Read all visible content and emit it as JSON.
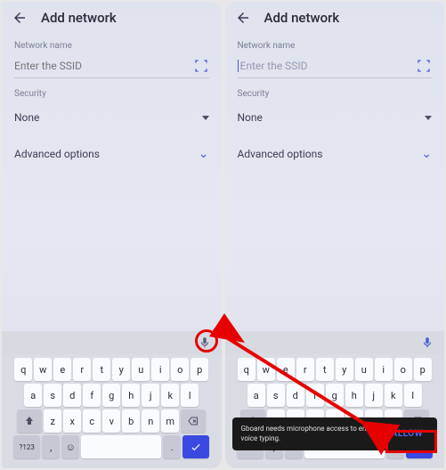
{
  "left": {
    "title": "Add network",
    "network_label": "Network name",
    "placeholder": "Enter the SSID",
    "security_label": "Security",
    "security_value": "None",
    "advanced": "Advanced options"
  },
  "right": {
    "title": "Add network",
    "network_label": "Network name",
    "placeholder": "Enter the SSID",
    "security_label": "Security",
    "security_value": "None",
    "advanced": "Advanced options",
    "snackbar_text": "Gboard needs microphone access to enable voice typing.",
    "allow": "ALLOW"
  },
  "keyboard": {
    "row1": [
      "q",
      "w",
      "e",
      "r",
      "t",
      "y",
      "u",
      "i",
      "o",
      "p"
    ],
    "row2": [
      "a",
      "s",
      "d",
      "f",
      "g",
      "h",
      "j",
      "k",
      "l"
    ],
    "row3": [
      "z",
      "x",
      "c",
      "v",
      "b",
      "n",
      "m"
    ],
    "symkey": "?123",
    "comma": ",",
    "period": "."
  }
}
